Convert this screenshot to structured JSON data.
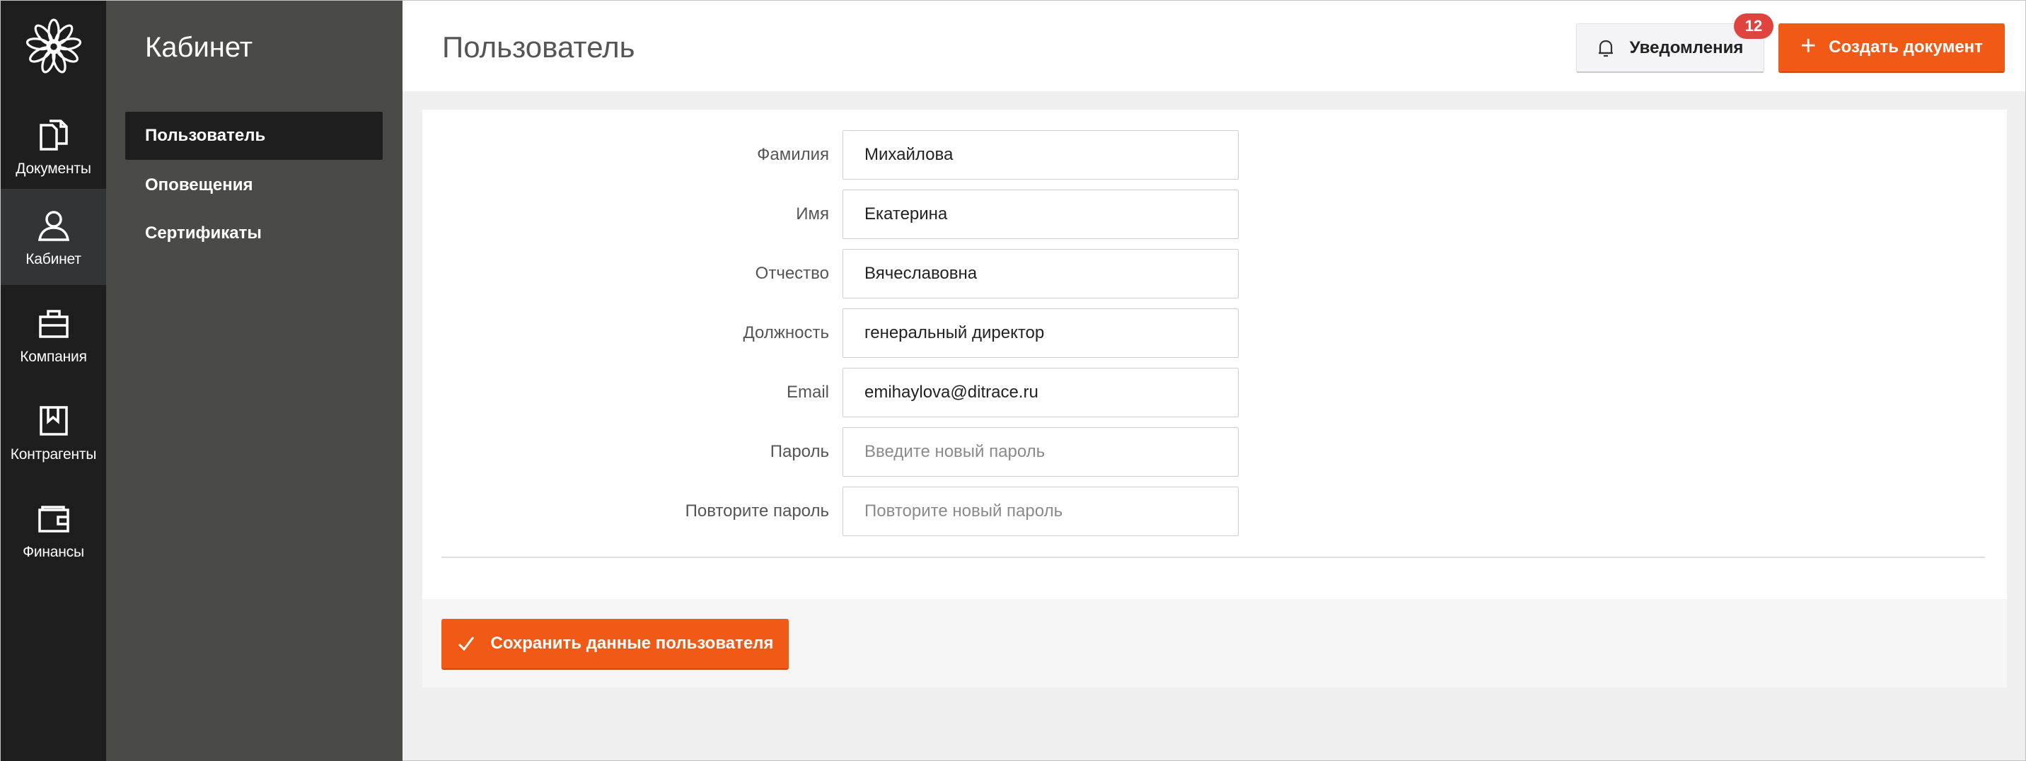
{
  "rail": {
    "logo_icon": "flower-logo-icon",
    "items": [
      {
        "label": "Документы",
        "icon": "documents-icon"
      },
      {
        "label": "Кабинет",
        "icon": "user-icon",
        "active": true
      },
      {
        "label": "Компания",
        "icon": "briefcase-icon"
      },
      {
        "label": "Контрагенты",
        "icon": "bookmark-book-icon"
      },
      {
        "label": "Финансы",
        "icon": "wallet-icon"
      }
    ]
  },
  "subnav": {
    "title": "Кабинет",
    "items": [
      {
        "label": "Пользователь",
        "active": true
      },
      {
        "label": "Оповещения"
      },
      {
        "label": "Сертификаты"
      }
    ]
  },
  "header": {
    "title": "Пользователь",
    "notifications_label": "Уведомления",
    "notifications_count": "12",
    "create_label": "Создать документ"
  },
  "form": {
    "last_name": {
      "label": "Фамилия",
      "value": "Михайлова"
    },
    "first_name": {
      "label": "Имя",
      "value": "Екатерина"
    },
    "middle_name": {
      "label": "Отчество",
      "value": "Вячеславовна"
    },
    "position": {
      "label": "Должность",
      "value": "генеральный директор"
    },
    "email": {
      "label": "Email",
      "value": "emihaylova@ditrace.ru"
    },
    "password": {
      "label": "Пароль",
      "placeholder": "Введите новый пароль"
    },
    "password_repeat": {
      "label": "Повторите пароль",
      "placeholder": "Повторите новый пароль"
    },
    "save_label": "Сохранить данные пользователя"
  },
  "colors": {
    "accent": "#f05a16",
    "rail_bg": "#1e1e1e",
    "subnav_bg": "#4a4a48",
    "badge": "#e0443e",
    "content_bg": "#efefef"
  }
}
